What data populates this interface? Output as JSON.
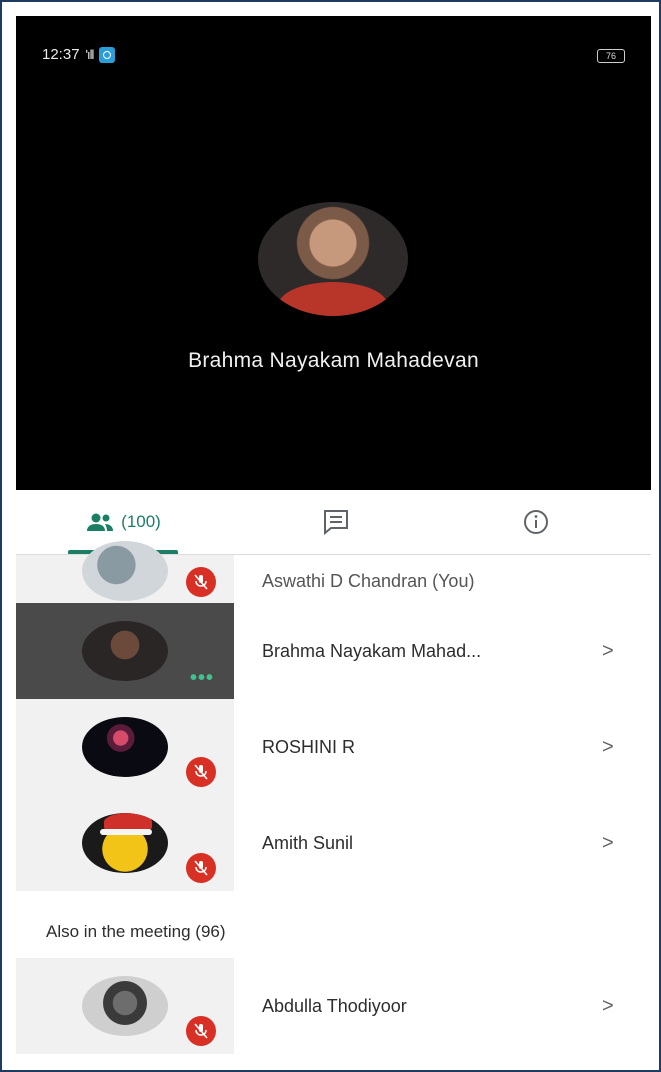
{
  "status_bar": {
    "time": "12:37",
    "signal": "ᵛᵒˡˡ",
    "battery": "76"
  },
  "speaker": {
    "name": "Brahma Nayakam Mahadevan"
  },
  "tabs": {
    "people_count": "(100)"
  },
  "participants": [
    {
      "name": "Aswathi D Chandran (You)",
      "muted": true
    },
    {
      "name": "Brahma Nayakam Mahad...",
      "muted": false,
      "chevron": ">"
    },
    {
      "name": "ROSHINI R",
      "muted": true,
      "chevron": ">"
    },
    {
      "name": "Amith Sunil",
      "muted": true,
      "chevron": ">"
    }
  ],
  "also_in_meeting": {
    "label": "Also in the meeting (96)",
    "items": [
      {
        "name": "Abdulla Thodiyoor",
        "muted": true,
        "chevron": ">"
      }
    ]
  },
  "colors": {
    "accent": "#1a7f65",
    "mute_red": "#d93025",
    "video_bg": "#000000"
  },
  "icons": [
    "people-icon",
    "chat-icon",
    "info-icon",
    "mic-off-icon",
    "chevron-right-icon",
    "more-dots-icon"
  ]
}
